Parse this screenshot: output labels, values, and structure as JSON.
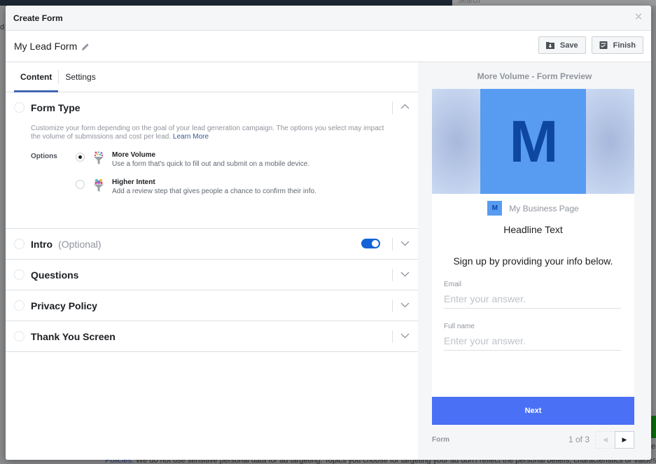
{
  "background": {
    "search_placeholder": "Search",
    "left_fragment": "d",
    "footer_link": "Policies.",
    "footer_text": " We do not use sensitive personal data for ad targeting. Topics you choose for targeting your ad don't reflect the personal beliefs, characteristics or values of users. Failure",
    "right_fragment": "er"
  },
  "modal": {
    "title": "Create Form",
    "close_icon": "close-icon"
  },
  "form": {
    "name": "My Lead Form",
    "edit_icon": "pencil-icon",
    "actions": {
      "save_label": "Save",
      "finish_label": "Finish"
    }
  },
  "tabs": [
    {
      "label": "Content",
      "active": true
    },
    {
      "label": "Settings",
      "active": false
    }
  ],
  "sections": {
    "form_type": {
      "title": "Form Type",
      "expanded": true,
      "description": "Customize your form depending on the goal of your lead generation campaign. The options you select may impact the volume of submissions and cost per lead.",
      "learn_more": "Learn More",
      "options_label": "Options",
      "options": [
        {
          "title": "More Volume",
          "description": "Use a form that's quick to fill out and submit on a mobile device.",
          "selected": true
        },
        {
          "title": "Higher Intent",
          "description": "Add a review step that gives people a chance to confirm their info.",
          "selected": false
        }
      ]
    },
    "intro": {
      "title": "Intro",
      "optional": "(Optional)",
      "toggle_on": true
    },
    "questions": {
      "title": "Questions"
    },
    "privacy_policy": {
      "title": "Privacy Policy"
    },
    "thank_you": {
      "title": "Thank You Screen"
    }
  },
  "preview": {
    "title": "More Volume - Form Preview",
    "cover_letter": "M",
    "page_avatar_letter": "M",
    "page_name": "My Business Page",
    "headline": "Headline Text",
    "intro_text": "Sign up by providing your info below.",
    "fields": [
      {
        "label": "Email",
        "placeholder": "Enter your answer."
      },
      {
        "label": "Full name",
        "placeholder": "Enter your answer."
      }
    ],
    "next_label": "Next",
    "footer_label": "Form",
    "page_indicator": "1 of 3",
    "colors": {
      "accent": "#4a70f5",
      "brand_square": "#589cf2",
      "brand_letter": "#0d47a1",
      "toggle": "#1264d6",
      "tab_underline": "#4267b2"
    }
  }
}
